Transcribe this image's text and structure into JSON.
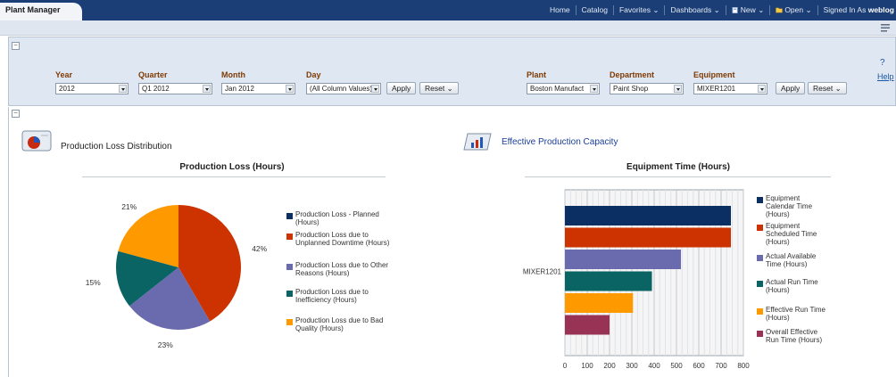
{
  "app": {
    "title": "Plant Manager"
  },
  "nav": {
    "home": "Home",
    "catalog": "Catalog",
    "favorites": "Favorites",
    "dashboards": "Dashboards",
    "new": "New",
    "open": "Open",
    "signed_in_label": "Signed In As",
    "user": "weblog"
  },
  "prompts_left": {
    "year": {
      "label": "Year",
      "value": "2012"
    },
    "quarter": {
      "label": "Quarter",
      "value": "Q1 2012"
    },
    "month": {
      "label": "Month",
      "value": "Jan 2012"
    },
    "day": {
      "label": "Day",
      "value": "(All Column Values)"
    },
    "apply": "Apply",
    "reset": "Reset"
  },
  "prompts_right": {
    "plant": {
      "label": "Plant",
      "value": "Boston Manufact"
    },
    "department": {
      "label": "Department",
      "value": "Paint Shop"
    },
    "equipment": {
      "label": "Equipment",
      "value": "MIXER1201"
    },
    "apply": "Apply",
    "reset": "Reset"
  },
  "help": {
    "icon_text": "?",
    "link": "Help"
  },
  "sections": {
    "left_title": "Production Loss Distribution",
    "right_title": "Effective Production Capacity"
  },
  "colors": {
    "navy": "#0b2e63",
    "red": "#cc3300",
    "purple": "#6a6aae",
    "teal": "#0b6464",
    "orange": "#ff9900",
    "maroon": "#993355",
    "title_link": "#1a3e9a",
    "prompt_label": "#7d3a04"
  },
  "chart_data": [
    {
      "type": "pie",
      "title": "Production Loss (Hours)",
      "slices": [
        {
          "name": "Production Loss - Planned (Hours)",
          "value": 0,
          "label": "",
          "color": "#0b2e63"
        },
        {
          "name": "Production Loss due to Unplanned Downtime (Hours)",
          "value": 42,
          "label": "42%",
          "color": "#cc3300"
        },
        {
          "name": "Production Loss due to Other Reasons (Hours)",
          "value": 23,
          "label": "23%",
          "color": "#6a6aae"
        },
        {
          "name": "Production Loss due to Inefficiency (Hours)",
          "value": 15,
          "label": "15%",
          "color": "#0b6464"
        },
        {
          "name": "Production Loss due to Bad Quality (Hours)",
          "value": 21,
          "label": "21%",
          "color": "#ff9900"
        }
      ]
    },
    {
      "type": "bar",
      "orientation": "horizontal",
      "title": "Equipment Time (Hours)",
      "categories": [
        "MIXER1201"
      ],
      "xlim": [
        0,
        800
      ],
      "ticks": [
        0,
        100,
        200,
        300,
        400,
        500,
        600,
        700,
        800
      ],
      "grid": true,
      "legend": "right",
      "series": [
        {
          "name": "Equipment Calendar Time (Hours)",
          "value": 744,
          "color": "#0b2e63"
        },
        {
          "name": "Equipment Scheduled Time (Hours)",
          "value": 744,
          "color": "#cc3300"
        },
        {
          "name": "Actual Available Time (Hours)",
          "value": 520,
          "color": "#6a6aae"
        },
        {
          "name": "Actual Run Time (Hours)",
          "value": 390,
          "color": "#0b6464"
        },
        {
          "name": "Effective Run Time (Hours)",
          "value": 305,
          "color": "#ff9900"
        },
        {
          "name": "Overall Effective Run Time (Hours)",
          "value": 200,
          "color": "#993355"
        }
      ]
    }
  ]
}
